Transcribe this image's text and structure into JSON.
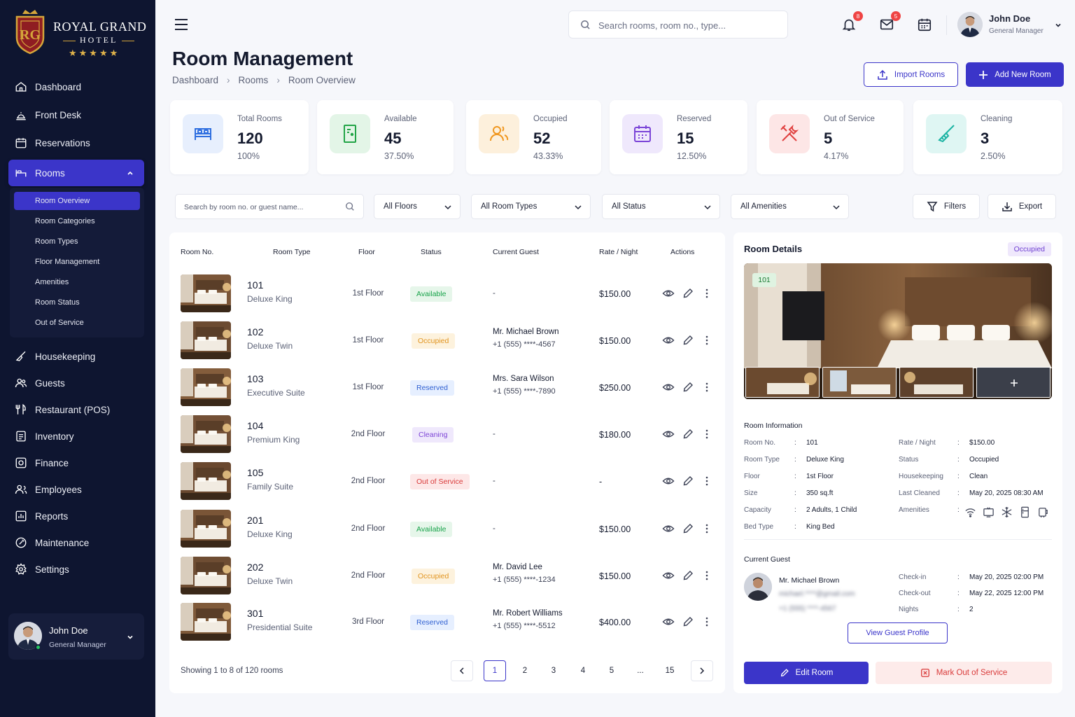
{
  "brand": {
    "name": "ROYAL GRAND",
    "sub": "HOTEL",
    "stars": "★★★★★"
  },
  "sidebar": {
    "items": [
      {
        "label": "Dashboard",
        "icon": "home-icon"
      },
      {
        "label": "Front Desk",
        "icon": "bell-icon"
      },
      {
        "label": "Reservations",
        "icon": "calendar-icon"
      },
      {
        "label": "Rooms",
        "icon": "bed-icon"
      },
      {
        "label": "Housekeeping",
        "icon": "broom-icon"
      },
      {
        "label": "Guests",
        "icon": "users-icon"
      },
      {
        "label": "Restaurant (POS)",
        "icon": "utensils-icon"
      },
      {
        "label": "Inventory",
        "icon": "clipboard-icon"
      },
      {
        "label": "Finance",
        "icon": "wallet-icon"
      },
      {
        "label": "Employees",
        "icon": "employees-icon"
      },
      {
        "label": "Reports",
        "icon": "report-icon"
      },
      {
        "label": "Maintenance",
        "icon": "wrench-icon"
      },
      {
        "label": "Settings",
        "icon": "gear-icon"
      }
    ],
    "rooms_sub": [
      "Room Overview",
      "Room Categories",
      "Room Types",
      "Floor Management",
      "Amenities",
      "Room Status",
      "Out of Service"
    ],
    "user": {
      "name": "John Doe",
      "role": "General Manager"
    }
  },
  "topbar": {
    "search_placeholder": "Search rooms, room no., type...",
    "notifications": "8",
    "messages": "5",
    "user_name": "John Doe",
    "user_role": "General Manager"
  },
  "page": {
    "title": "Room Management",
    "breadcrumb": [
      "Dashboard",
      "Rooms",
      "Room Overview"
    ],
    "import_label": "Import Rooms",
    "add_label": "Add New Room"
  },
  "stats": [
    {
      "label": "Total Rooms",
      "value": "120",
      "pct": "100%",
      "icon": "bed-icon",
      "color": "#2f6fe0",
      "bg": "#e7effd"
    },
    {
      "label": "Available",
      "value": "45",
      "pct": "37.50%",
      "icon": "door-icon",
      "color": "#22a447",
      "bg": "#e3f5e7"
    },
    {
      "label": "Occupied",
      "value": "52",
      "pct": "43.33%",
      "icon": "user-icon",
      "color": "#f0971f",
      "bg": "#fdf0dc"
    },
    {
      "label": "Reserved",
      "value": "15",
      "pct": "12.50%",
      "icon": "calendar-icon",
      "color": "#7b45d8",
      "bg": "#efe8fc"
    },
    {
      "label": "Out of Service",
      "value": "5",
      "pct": "4.17%",
      "icon": "tools-icon",
      "color": "#e0403f",
      "bg": "#fde6e6"
    },
    {
      "label": "Cleaning",
      "value": "3",
      "pct": "2.50%",
      "icon": "broom-icon",
      "color": "#1bb3a3",
      "bg": "#dff6f3"
    }
  ],
  "filters": {
    "search_placeholder": "Search by room no. or guest name...",
    "floors": "All Floors",
    "room_types": "All Room Types",
    "status": "All Status",
    "amenities": "All Amenities",
    "filters_label": "Filters",
    "export_label": "Export"
  },
  "table": {
    "headers": [
      "Room No.",
      "Room Type",
      "Floor",
      "Status",
      "Current Guest",
      "Rate / Night",
      "Actions"
    ],
    "rows": [
      {
        "no": "101",
        "type": "Deluxe King",
        "floor": "1st Floor",
        "status": "Available",
        "status_key": "available",
        "guest": "-",
        "phone": "",
        "rate": "$150.00"
      },
      {
        "no": "102",
        "type": "Deluxe Twin",
        "floor": "1st Floor",
        "status": "Occupied",
        "status_key": "occupied",
        "guest": "Mr. Michael Brown",
        "phone": "+1 (555) ****-4567",
        "rate": "$150.00"
      },
      {
        "no": "103",
        "type": "Executive Suite",
        "floor": "1st Floor",
        "status": "Reserved",
        "status_key": "reserved",
        "guest": "Mrs. Sara Wilson",
        "phone": "+1 (555) ****-7890",
        "rate": "$250.00"
      },
      {
        "no": "104",
        "type": "Premium King",
        "floor": "2nd Floor",
        "status": "Cleaning",
        "status_key": "cleaning",
        "guest": "-",
        "phone": "",
        "rate": "$180.00"
      },
      {
        "no": "105",
        "type": "Family Suite",
        "floor": "2nd Floor",
        "status": "Out of Service",
        "status_key": "out",
        "guest": "-",
        "phone": "",
        "rate": "-"
      },
      {
        "no": "201",
        "type": "Deluxe King",
        "floor": "2nd Floor",
        "status": "Available",
        "status_key": "available",
        "guest": "-",
        "phone": "",
        "rate": "$150.00"
      },
      {
        "no": "202",
        "type": "Deluxe Twin",
        "floor": "2nd Floor",
        "status": "Occupied",
        "status_key": "occupied",
        "guest": "Mr. David Lee",
        "phone": "+1 (555) ****-1234",
        "rate": "$150.00"
      },
      {
        "no": "301",
        "type": "Presidential Suite",
        "floor": "3rd Floor",
        "status": "Reserved",
        "status_key": "reserved",
        "guest": "Mr. Robert Williams",
        "phone": "+1 (555) ****-5512",
        "rate": "$400.00"
      }
    ],
    "showing": "Showing 1 to 8 of 120 rooms",
    "pages": [
      "1",
      "2",
      "3",
      "4",
      "5",
      "...",
      "15"
    ],
    "current_page": "1"
  },
  "details": {
    "title": "Room Details",
    "badge": "Occupied",
    "room_no_tag": "101",
    "info_title": "Room Information",
    "left": [
      {
        "k": "Room No.",
        "v": "101"
      },
      {
        "k": "Room Type",
        "v": "Deluxe King"
      },
      {
        "k": "Floor",
        "v": "1st Floor"
      },
      {
        "k": "Size",
        "v": "350 sq.ft"
      },
      {
        "k": "Capacity",
        "v": "2 Adults, 1 Child"
      },
      {
        "k": "Bed Type",
        "v": "King Bed"
      }
    ],
    "right": [
      {
        "k": "Rate / Night",
        "v": "$150.00"
      },
      {
        "k": "Status",
        "v": "Occupied"
      },
      {
        "k": "Housekeeping",
        "v": "Clean"
      },
      {
        "k": "Last Cleaned",
        "v": "May 20, 2025 08:30 AM"
      },
      {
        "k": "Amenities",
        "v": ""
      }
    ],
    "amenity_icons": [
      "wifi-icon",
      "tv-icon",
      "ac-icon",
      "fridge-icon",
      "coffee-icon"
    ],
    "guest_title": "Current Guest",
    "guest_name": "Mr. Michael Brown",
    "guest_email": "michael.****@gmail.com",
    "guest_phone": "+1 (555) ****-4567",
    "stay": [
      {
        "k": "Check-in",
        "v": "May 20, 2025 02:00 PM"
      },
      {
        "k": "Check-out",
        "v": "May 22, 2025 12:00 PM"
      },
      {
        "k": "Nights",
        "v": "2"
      }
    ],
    "view_profile": "View Guest Profile",
    "edit_label": "Edit Room",
    "oos_label": "Mark Out of Service"
  }
}
